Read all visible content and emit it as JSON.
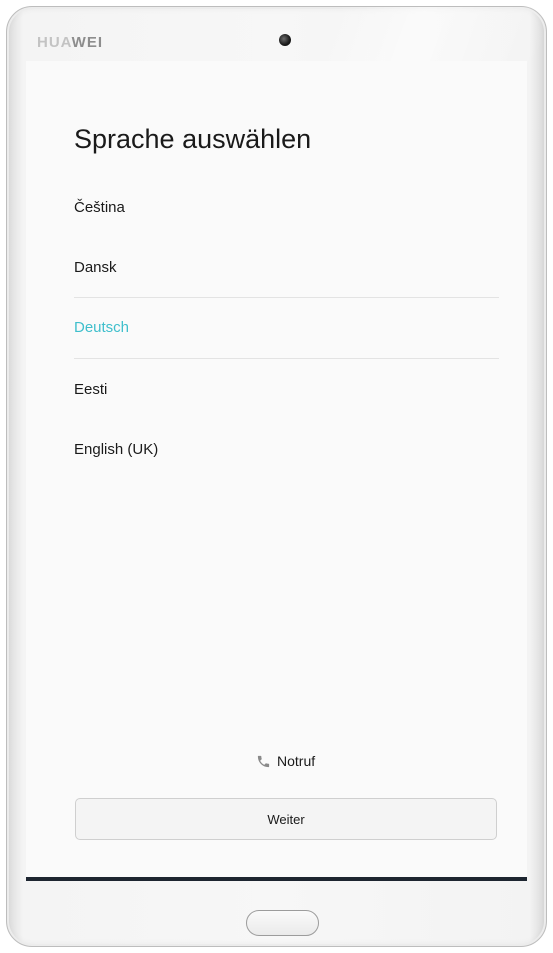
{
  "device": {
    "brand_light": "HUA",
    "brand_dark": "WEI"
  },
  "screen": {
    "title": "Sprache auswählen",
    "languages": [
      {
        "label": "Čeština",
        "selected": false
      },
      {
        "label": "Dansk",
        "selected": false
      },
      {
        "label": "Deutsch",
        "selected": true
      },
      {
        "label": "Eesti",
        "selected": false
      },
      {
        "label": "English (UK)",
        "selected": false
      }
    ],
    "emergency_label": "Notruf",
    "emergency_icon": "phone-icon",
    "next_button_label": "Weiter"
  },
  "colors": {
    "accent": "#3fbfcc",
    "text": "#1a1a1a",
    "screen_bg": "#fafafa"
  }
}
